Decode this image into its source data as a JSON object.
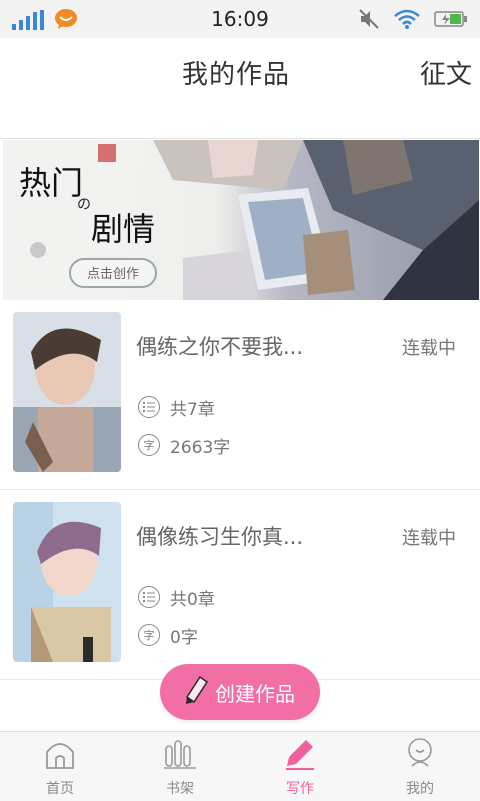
{
  "status_bar": {
    "time": "16:09"
  },
  "header": {
    "title": "我的作品",
    "right_link": "征文"
  },
  "banner": {
    "headline_1": "热门",
    "connector": "の",
    "headline_2": "剧情",
    "cta_label": "点击创作"
  },
  "works": [
    {
      "title": "偶练之你不要我...",
      "status": "连载中",
      "chapters": "共7章",
      "words": "2663字"
    },
    {
      "title": "偶像练习生你真...",
      "status": "连载中",
      "chapters": "共0章",
      "words": "0字"
    }
  ],
  "create_button": {
    "label": "创建作品"
  },
  "tabs": [
    {
      "label": "首页",
      "icon": "home-icon",
      "active": false
    },
    {
      "label": "书架",
      "icon": "bookshelf-icon",
      "active": false
    },
    {
      "label": "写作",
      "icon": "pen-icon",
      "active": true
    },
    {
      "label": "我的",
      "icon": "profile-icon",
      "active": false
    }
  ],
  "colors": {
    "accent": "#f26fa5",
    "active_tab": "#f0609c",
    "text_primary": "#333333",
    "text_secondary": "#777777"
  }
}
